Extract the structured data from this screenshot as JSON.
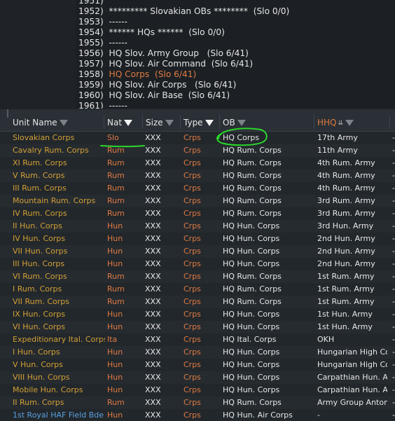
{
  "listing": {
    "lines": [
      {
        "num": "1951)",
        "text": ""
      },
      {
        "num": "1952)",
        "text": "********* Slovakian OBs ********  (Slo 0/0)"
      },
      {
        "num": "1953)",
        "text": "------"
      },
      {
        "num": "1954)",
        "text": "****** HQs ******  (Slo 0/0)"
      },
      {
        "num": "1955)",
        "text": "------"
      },
      {
        "num": "1956)",
        "text": "HQ Slov. Army Group   (Slo 6/41)"
      },
      {
        "num": "1957)",
        "text": "HQ Slov. Air Command  (Slo 6/41)"
      },
      {
        "num": "1958)",
        "text": "HQ Corps  (Slo 6/41)",
        "highlight": true
      },
      {
        "num": "1959)",
        "text": "HQ Slov. Air Corps   (Slo 6/41)"
      },
      {
        "num": "1960)",
        "text": "HQ Slov. Air Base  (Slo 6/41)"
      },
      {
        "num": "1961)",
        "text": "------"
      }
    ]
  },
  "table": {
    "headers": {
      "unit_name": "Unit Name",
      "nat": "Nat",
      "size": "Size",
      "type": "Type",
      "ob": "OB",
      "hhq": "HHQ"
    },
    "rows": [
      {
        "name": "Slovakian Corps",
        "nat": "Slo",
        "size": "XXX",
        "type": "Crps",
        "ob": "HQ Corps",
        "hhq": "17th Army",
        "dash": "-"
      },
      {
        "name": "Cavalry Rum. Corps",
        "nat": "Rum",
        "size": "XXX",
        "type": "Crps",
        "ob": "HQ Rum. Corps",
        "hhq": "11th Army",
        "dash": "-"
      },
      {
        "name": "XI Rum. Corps",
        "nat": "Rum",
        "size": "XXX",
        "type": "Crps",
        "ob": "HQ Rum. Corps",
        "hhq": "4th Rum. Army",
        "dash": "-"
      },
      {
        "name": "V Rum. Corps",
        "nat": "Rum",
        "size": "XXX",
        "type": "Crps",
        "ob": "HQ Rum. Corps",
        "hhq": "4th Rum. Army",
        "dash": "-"
      },
      {
        "name": "III Rum. Corps",
        "nat": "Rum",
        "size": "XXX",
        "type": "Crps",
        "ob": "HQ Rum. Corps",
        "hhq": "4th Rum. Army",
        "dash": "-"
      },
      {
        "name": "Mountain Rum. Corps",
        "nat": "Rum",
        "size": "XXX",
        "type": "Crps",
        "ob": "HQ Rum. Corps",
        "hhq": "3rd Rum. Army",
        "dash": "-"
      },
      {
        "name": "IV Rum. Corps",
        "nat": "Rum",
        "size": "XXX",
        "type": "Crps",
        "ob": "HQ Rum. Corps",
        "hhq": "3rd Rum. Army",
        "dash": "-"
      },
      {
        "name": "II Hun. Corps",
        "nat": "Hun",
        "size": "XXX",
        "type": "Crps",
        "ob": "HQ Hun. Corps",
        "hhq": "3rd Hun. Army",
        "dash": "-"
      },
      {
        "name": "IV Hun. Corps",
        "nat": "Hun",
        "size": "XXX",
        "type": "Crps",
        "ob": "HQ Hun. Corps",
        "hhq": "2nd Hun. Army",
        "dash": "-"
      },
      {
        "name": "VII Hun. Corps",
        "nat": "Hun",
        "size": "XXX",
        "type": "Crps",
        "ob": "HQ Hun. Corps",
        "hhq": "2nd Hun. Army",
        "dash": "-"
      },
      {
        "name": "III Hun. Corps",
        "nat": "Hun",
        "size": "XXX",
        "type": "Crps",
        "ob": "HQ Hun. Corps",
        "hhq": "2nd Hun. Army",
        "dash": "-"
      },
      {
        "name": "VI Rum. Corps",
        "nat": "Rum",
        "size": "XXX",
        "type": "Crps",
        "ob": "HQ Rum. Corps",
        "hhq": "1st Rum. Army",
        "dash": "-"
      },
      {
        "name": "I Rum. Corps",
        "nat": "Rum",
        "size": "XXX",
        "type": "Crps",
        "ob": "HQ Rum. Corps",
        "hhq": "1st Rum. Army",
        "dash": "-"
      },
      {
        "name": "VII Rum. Corps",
        "nat": "Rum",
        "size": "XXX",
        "type": "Crps",
        "ob": "HQ Rum. Corps",
        "hhq": "1st Rum. Army",
        "dash": "-"
      },
      {
        "name": "IX Hun. Corps",
        "nat": "Hun",
        "size": "XXX",
        "type": "Crps",
        "ob": "HQ Hun. Corps",
        "hhq": "1st Hun. Army",
        "dash": "-"
      },
      {
        "name": "VI Hun. Corps",
        "nat": "Hun",
        "size": "XXX",
        "type": "Crps",
        "ob": "HQ Hun. Corps",
        "hhq": "1st Hun. Army",
        "dash": "-"
      },
      {
        "name": "Expeditionary Ital. Corps",
        "nat": "Ita",
        "size": "XXX",
        "type": "Crps",
        "ob": "HQ Ital. Corps",
        "hhq": "OKH",
        "dash": "-"
      },
      {
        "name": "I Hun. Corps",
        "nat": "Hun",
        "size": "XXX",
        "type": "Crps",
        "ob": "HQ Hun. Corps",
        "hhq": "Hungarian High Co",
        "dash": "-"
      },
      {
        "name": "V Hun. Corps",
        "nat": "Hun",
        "size": "XXX",
        "type": "Crps",
        "ob": "HQ Hun. Corps",
        "hhq": "Hungarian High Co",
        "dash": "-"
      },
      {
        "name": "VIII Hun. Corps",
        "nat": "Hun",
        "size": "XXX",
        "type": "Crps",
        "ob": "HQ Hun. Corps",
        "hhq": "Carpathian Hun. Ar",
        "dash": "-"
      },
      {
        "name": "Mobile Hun. Corps",
        "nat": "Hun",
        "size": "XXX",
        "type": "Crps",
        "ob": "HQ Hun. Corps",
        "hhq": "Carpathian Hun. Ar",
        "dash": "-"
      },
      {
        "name": "II Rum. Corps",
        "nat": "Rum",
        "size": "XXX",
        "type": "Crps",
        "ob": "HQ Rum. Corps",
        "hhq": "Army Group Antone",
        "dash": "-"
      },
      {
        "name": "1st Royal HAF Field Bde",
        "nat": "Hun",
        "size": "XXX",
        "type": "Crps",
        "ob": "HQ Hun. Air Corps",
        "hhq": "-",
        "dash": "-",
        "name_color": "blue"
      }
    ]
  },
  "colors": {
    "accent_orange": "#e07a42",
    "unit_gold": "#d2a036",
    "unit_blue": "#5aa0df",
    "annotation_green": "#2bd62b"
  },
  "icons": {
    "filter": "filter-funnel-icon",
    "sort": "sort-desc-icon"
  }
}
